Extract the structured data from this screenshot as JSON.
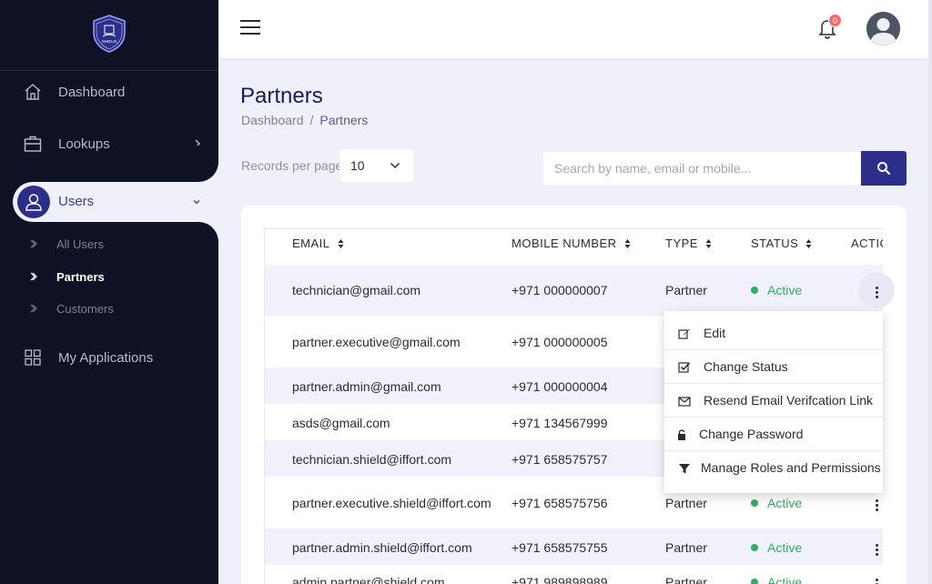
{
  "sidebar": {
    "logo_text": "SHIELD",
    "items": [
      {
        "label": "Dashboard",
        "icon": "home-icon"
      },
      {
        "label": "Lookups",
        "icon": "briefcase-icon"
      },
      {
        "label": "Users",
        "icon": "user-icon",
        "expanded": true
      },
      {
        "label": "My Applications",
        "icon": "grid-icon"
      }
    ],
    "user_subitems": [
      {
        "label": "All Users",
        "active": false
      },
      {
        "label": "Partners",
        "active": true
      },
      {
        "label": "Customers",
        "active": false
      }
    ]
  },
  "header": {
    "notification_count": "0"
  },
  "page": {
    "title": "Partners",
    "breadcrumb": [
      "Dashboard",
      "Partners"
    ],
    "breadcrumb_sep": "/"
  },
  "controls": {
    "records_label": "Records per page",
    "records_value": "10",
    "search_placeholder": "Search by name, email or mobile..."
  },
  "table": {
    "columns": [
      "EMAIL",
      "MOBILE NUMBER",
      "TYPE",
      "STATUS",
      "ACTIO"
    ],
    "rows": [
      {
        "email": "technician@gmail.com",
        "mobile": "+971 000000007",
        "type": "Partner",
        "status": "Active"
      },
      {
        "email": "partner.executive@gmail.com",
        "mobile": "+971 000000005",
        "type": "",
        "status": ""
      },
      {
        "email": "partner.admin@gmail.com",
        "mobile": "+971 000000004",
        "type": "",
        "status": ""
      },
      {
        "email": "asds@gmail.com",
        "mobile": "+971 134567999",
        "type": "",
        "status": ""
      },
      {
        "email": "technician.shield@iffort.com",
        "mobile": "+971 658575757",
        "type": "",
        "status": ""
      },
      {
        "email": "partner.executive.shield@iffort.com",
        "mobile": "+971 658575756",
        "type": "Partner",
        "status": "Active"
      },
      {
        "email": "partner.admin.shield@iffort.com",
        "mobile": "+971 658575755",
        "type": "Partner",
        "status": "Active"
      },
      {
        "email": "admin.partner@shield.com",
        "mobile": "+971 989898989",
        "type": "Partner",
        "status": "Active"
      }
    ]
  },
  "action_menu": [
    {
      "label": "Edit",
      "icon": "edit-icon"
    },
    {
      "label": "Change Status",
      "icon": "checkbox-icon"
    },
    {
      "label": "Resend Email Verifcation Link",
      "icon": "envelope-icon"
    },
    {
      "label": "Change Password",
      "icon": "lock-icon"
    },
    {
      "label": "Manage Roles and Permissions",
      "icon": "filter-icon"
    }
  ],
  "colors": {
    "sidebar_bg": "#0f1125",
    "accent": "#2c2e8a",
    "active_status": "#2fae62",
    "badge": "#f26b6b",
    "page_bg": "#eff0f9"
  }
}
